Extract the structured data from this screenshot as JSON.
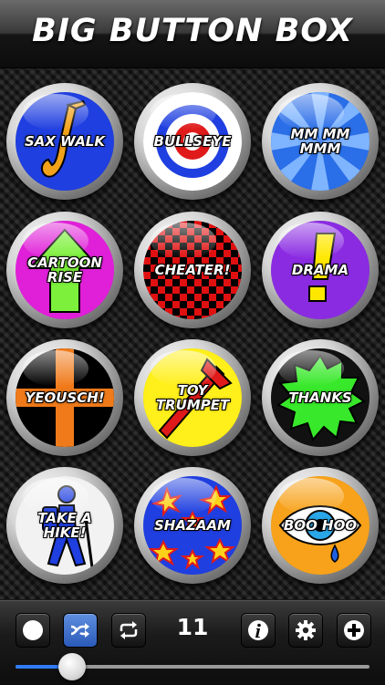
{
  "app": {
    "title": "BIG BUTTON BOX"
  },
  "buttons": [
    {
      "label": "SAX WALK",
      "theme": "blue-saxophone"
    },
    {
      "label": "BULLSEYE",
      "theme": "target"
    },
    {
      "label": "MM MM\nMMM",
      "theme": "blue-rays"
    },
    {
      "label": "CARTOON\nRISE",
      "theme": "magenta-up-arrow"
    },
    {
      "label": "CHEATER!",
      "theme": "red-checkerboard"
    },
    {
      "label": "DRAMA",
      "theme": "purple-exclamation"
    },
    {
      "label": "YEOUSCH!",
      "theme": "orange-cross"
    },
    {
      "label": "TOY\nTRUMPET",
      "theme": "yellow-trumpet"
    },
    {
      "label": "THANKS",
      "theme": "green-burst"
    },
    {
      "label": "TAKE A\nHIKE!",
      "theme": "hiker"
    },
    {
      "label": "SHAZAAM",
      "theme": "blue-stars"
    },
    {
      "label": "BOO HOO",
      "theme": "orange-eye-tear"
    }
  ],
  "toolbar": {
    "icons": [
      "record-icon",
      "shuffle-icon",
      "repeat-icon",
      "info-icon",
      "gear-icon",
      "plus-icon"
    ],
    "page_count": "11",
    "volume": 0.16
  },
  "colors": {
    "accent": "#2f7cf6"
  }
}
